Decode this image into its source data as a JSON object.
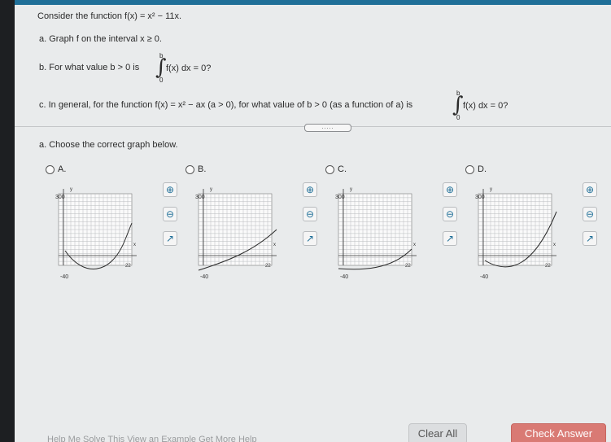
{
  "question": {
    "intro": "Consider the function f(x) = x² − 11x.",
    "part_a": "a. Graph f on the interval x ≥ 0.",
    "part_b_prefix": "b. For what value b > 0 is",
    "part_b_integrand": "f(x) dx = 0?",
    "part_c_prefix": "c. In general, for the function f(x) = x² − ax (a > 0), for what value of b > 0 (as a function of a) is",
    "part_c_integrand": "f(x) dx = 0?",
    "integral_upper": "b",
    "integral_lower": "0"
  },
  "expand_dots": ".....",
  "prompt": "a. Choose the correct graph below.",
  "options": [
    {
      "label": "A.",
      "y_max_label": "300",
      "y_min_label": "-40",
      "x_label": "x",
      "y_label": "y",
      "x_max_label": "22"
    },
    {
      "label": "B.",
      "y_max_label": "300",
      "y_min_label": "-40",
      "x_label": "x",
      "y_label": "y",
      "x_max_label": "22"
    },
    {
      "label": "C.",
      "y_max_label": "300",
      "y_min_label": "-40",
      "x_label": "x",
      "y_label": "y",
      "x_max_label": "22"
    },
    {
      "label": "D.",
      "y_max_label": "300",
      "y_min_label": "-40",
      "x_label": "x",
      "y_label": "y",
      "x_max_label": "22"
    }
  ],
  "icons": {
    "zoom_in": "zoom-in-icon",
    "zoom_out": "zoom-out-icon",
    "popout": "popout-icon"
  },
  "buttons": {
    "clear": "Clear All",
    "check": "Check Answer"
  },
  "bottom_nav": "Help Me Solve This   View an Example   Get More Help"
}
